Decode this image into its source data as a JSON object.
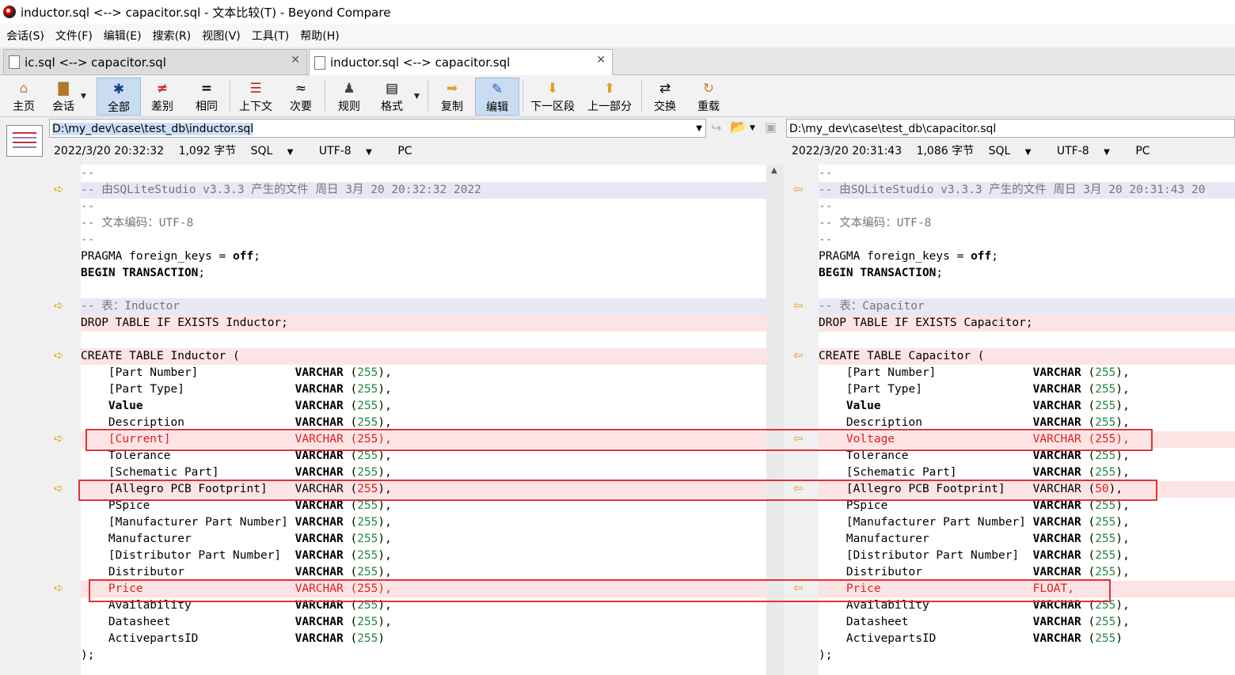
{
  "window": {
    "title": "inductor.sql <--> capacitor.sql - 文本比较(T) - Beyond Compare"
  },
  "menu": [
    "会话(S)",
    "文件(F)",
    "编辑(E)",
    "搜索(R)",
    "视图(V)",
    "工具(T)",
    "帮助(H)"
  ],
  "tabs": [
    {
      "label": "ic.sql <--> capacitor.sql"
    },
    {
      "label": "inductor.sql <--> capacitor.sql"
    }
  ],
  "toolbar": {
    "home": "主页",
    "session": "会话",
    "all": "全部",
    "diffs": "差别",
    "same": "相同",
    "context": "上下文",
    "minor": "次要",
    "rules": "规则",
    "format": "格式",
    "copy": "复制",
    "edit": "编辑",
    "next_section": "下一区段",
    "prev_section": "上一部分",
    "swap": "交换",
    "reload": "重载"
  },
  "left": {
    "path": "D:\\my_dev\\case\\test_db\\inductor.sql",
    "date": "2022/3/20 20:32:32",
    "size": "1,092 字节",
    "syntax": "SQL",
    "encoding": "UTF-8",
    "lineend": "PC"
  },
  "right": {
    "path": "D:\\my_dev\\case\\test_db\\capacitor.sql",
    "date": "2022/3/20 20:31:43",
    "size": "1,086 字节",
    "syntax": "SQL",
    "encoding": "UTF-8",
    "lineend": "PC"
  },
  "colors": {
    "diff_bg": "#fde4e4",
    "highlight_box": "#e53030",
    "selected_tool": "#c9dcf2"
  },
  "left_lines": [
    "--",
    "-- 由SQLiteStudio v3.3.3 产生的文件 周日 3月 20 20:32:32 2022",
    "--",
    "-- 文本编码：UTF-8",
    "--",
    "PRAGMA foreign_keys = off;",
    "BEGIN TRANSACTION;",
    "",
    "-- 表：Inductor",
    "DROP TABLE IF EXISTS Inductor;",
    "",
    "CREATE TABLE Inductor (",
    "    [Part Number]              VARCHAR (255),",
    "    [Part Type]                VARCHAR (255),",
    "    Value                      VARCHAR (255),",
    "    Description                VARCHAR (255),",
    "    [Current]                  VARCHAR (255),",
    "    Tolerance                  VARCHAR (255),",
    "    [Schematic Part]           VARCHAR (255),",
    "    [Allegro PCB Footprint]    VARCHAR (255),",
    "    PSpice                     VARCHAR (255),",
    "    [Manufacturer Part Number] VARCHAR (255),",
    "    Manufacturer               VARCHAR (255),",
    "    [Distributor Part Number]  VARCHAR (255),",
    "    Distributor                VARCHAR (255),",
    "    Price                      VARCHAR (255),",
    "    Availability               VARCHAR (255),",
    "    Datasheet                  VARCHAR (255),",
    "    ActivepartsID              VARCHAR (255)",
    ");"
  ],
  "right_lines": [
    "--",
    "-- 由SQLiteStudio v3.3.3 产生的文件 周日 3月 20 20:31:43 20",
    "--",
    "-- 文本编码：UTF-8",
    "--",
    "PRAGMA foreign_keys = off;",
    "BEGIN TRANSACTION;",
    "",
    "-- 表：Capacitor",
    "DROP TABLE IF EXISTS Capacitor;",
    "",
    "CREATE TABLE Capacitor (",
    "    [Part Number]              VARCHAR (255),",
    "    [Part Type]                VARCHAR (255),",
    "    Value                      VARCHAR (255),",
    "    Description                VARCHAR (255),",
    "    Voltage                    VARCHAR (255),",
    "    Tolerance                  VARCHAR (255),",
    "    [Schematic Part]           VARCHAR (255),",
    "    [Allegro PCB Footprint]    VARCHAR (50),",
    "    PSpice                     VARCHAR (255),",
    "    [Manufacturer Part Number] VARCHAR (255),",
    "    Manufacturer               VARCHAR (255),",
    "    [Distributor Part Number]  VARCHAR (255),",
    "    Distributor                VARCHAR (255),",
    "    Price                      FLOAT,",
    "    Availability               VARCHAR (255),",
    "    Datasheet                  VARCHAR (255),",
    "    ActivepartsID              VARCHAR (255)",
    ");"
  ]
}
